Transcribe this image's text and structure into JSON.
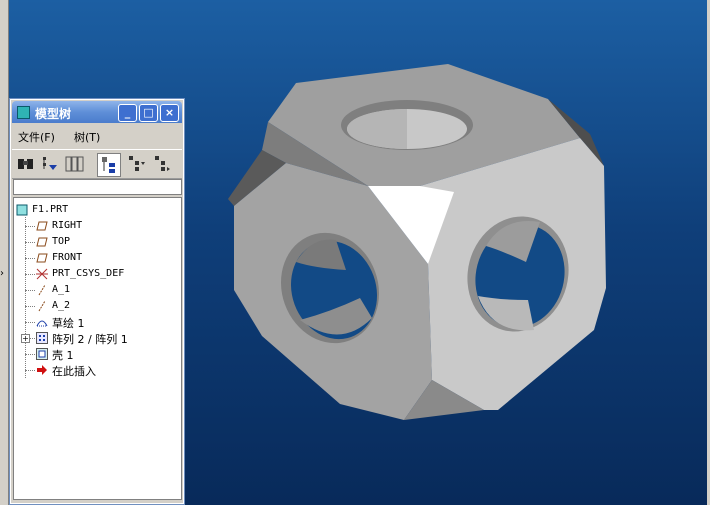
{
  "window": {
    "title": "模型树",
    "minimize": "_",
    "maximize": "□",
    "close": "×"
  },
  "menu": {
    "file": "文件(F)",
    "tree": "树(T)"
  },
  "toolbar": {
    "tools": [
      "binoculars-icon",
      "filter-icon",
      "columns-icon",
      "tree-view-icon",
      "expand-tree-icon",
      "collapse-tree-icon"
    ]
  },
  "filter": {
    "value": ""
  },
  "tree": {
    "root": "F1.PRT",
    "items": [
      {
        "label": "RIGHT",
        "icon": "datum-plane-icon"
      },
      {
        "label": "TOP",
        "icon": "datum-plane-icon"
      },
      {
        "label": "FRONT",
        "icon": "datum-plane-icon"
      },
      {
        "label": "PRT_CSYS_DEF",
        "icon": "coordinate-system-icon"
      },
      {
        "label": "A_1",
        "icon": "datum-axis-icon"
      },
      {
        "label": "A_2",
        "icon": "datum-axis-icon"
      },
      {
        "label": "草绘 1",
        "icon": "sketch-icon"
      },
      {
        "label": "阵列 2 / 阵列 1",
        "icon": "pattern-icon"
      },
      {
        "label": "壳 1",
        "icon": "shell-icon"
      },
      {
        "label": "在此插入",
        "icon": "insert-here-arrow-icon"
      }
    ]
  },
  "colors": {
    "viewport_top": "#1c5fa3",
    "viewport_bottom": "#082a5a",
    "model_light": "#c8c8c8",
    "model_mid": "#9a9a9a",
    "model_dark": "#555555"
  }
}
